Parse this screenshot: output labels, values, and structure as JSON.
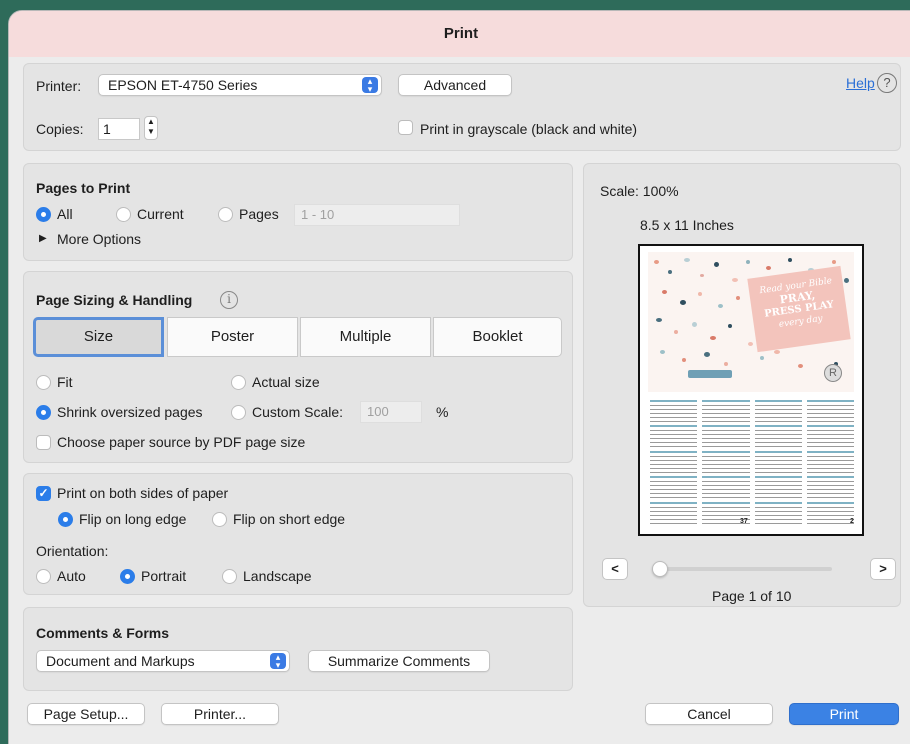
{
  "window": {
    "title": "Print"
  },
  "printer": {
    "label": "Printer:",
    "value": "EPSON ET-4750 Series",
    "advanced_label": "Advanced",
    "help_label": "Help",
    "help_icon": "?"
  },
  "copies": {
    "label": "Copies:",
    "value": "1",
    "grayscale_label": "Print in grayscale (black and white)",
    "grayscale_checked": false
  },
  "pages_to_print": {
    "title": "Pages to Print",
    "all_label": "All",
    "current_label": "Current",
    "pages_label": "Pages",
    "range_placeholder": "1 - 10",
    "selected": "All",
    "more_options_label": "More Options"
  },
  "sizing": {
    "title": "Page Sizing & Handling",
    "info_icon": "i",
    "tabs": [
      "Size",
      "Poster",
      "Multiple",
      "Booklet"
    ],
    "active_tab": "Size",
    "fit_label": "Fit",
    "actual_size_label": "Actual size",
    "shrink_label": "Shrink oversized pages",
    "custom_scale_label": "Custom Scale:",
    "custom_scale_value": "100",
    "percent_sign": "%",
    "paper_source_label": "Choose paper source by PDF page size",
    "selected": "Shrink oversized pages"
  },
  "duplex": {
    "both_sides_label": "Print on both sides of paper",
    "both_sides_checked": true,
    "flip_long_label": "Flip on long edge",
    "flip_short_label": "Flip on short edge",
    "flip_selected": "long",
    "orientation_label": "Orientation:",
    "auto_label": "Auto",
    "portrait_label": "Portrait",
    "landscape_label": "Landscape",
    "orientation_selected": "Portrait"
  },
  "comments": {
    "title": "Comments & Forms",
    "value": "Document and Markups",
    "summarize_label": "Summarize Comments"
  },
  "preview": {
    "scale_text": "Scale: 100%",
    "paper_size": "8.5 x 11 Inches",
    "page_text": "Page 1 of 10",
    "prev_label": "<",
    "next_label": ">",
    "slider_position": 0,
    "page_left_number": "37",
    "page_right_number": "2",
    "poster_text": [
      "Read your Bible",
      "PRAY,",
      "PRESS PLAY",
      "every day"
    ],
    "footer_badge": "R"
  },
  "footer": {
    "page_setup_label": "Page Setup...",
    "printer_label": "Printer...",
    "cancel_label": "Cancel",
    "print_label": "Print"
  },
  "colors": {
    "accent": "#2b7de9",
    "titlebar": "#f6dcdc",
    "background": "#ececec"
  }
}
